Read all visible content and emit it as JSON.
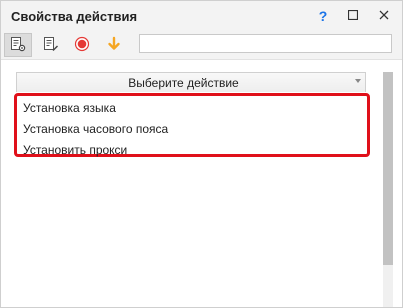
{
  "window": {
    "title": "Свойства действия",
    "help_label": "?",
    "maximize_icon": "square-icon",
    "close_icon": "x-icon"
  },
  "toolbar": {
    "tools": [
      {
        "icon": "properties-gear-icon",
        "active": true
      },
      {
        "icon": "document-edit-icon",
        "active": false
      },
      {
        "icon": "record-icon",
        "color": "#e53935",
        "active": false
      },
      {
        "icon": "arrow-down-icon",
        "color": "#f5a623",
        "active": false
      }
    ],
    "search_value": ""
  },
  "action_selector": {
    "label": "Выберите действие"
  },
  "action_list": {
    "items": [
      "Установка языка",
      "Установка часового пояса",
      "Установить прокси"
    ],
    "highlight_color": "#e0101a"
  }
}
